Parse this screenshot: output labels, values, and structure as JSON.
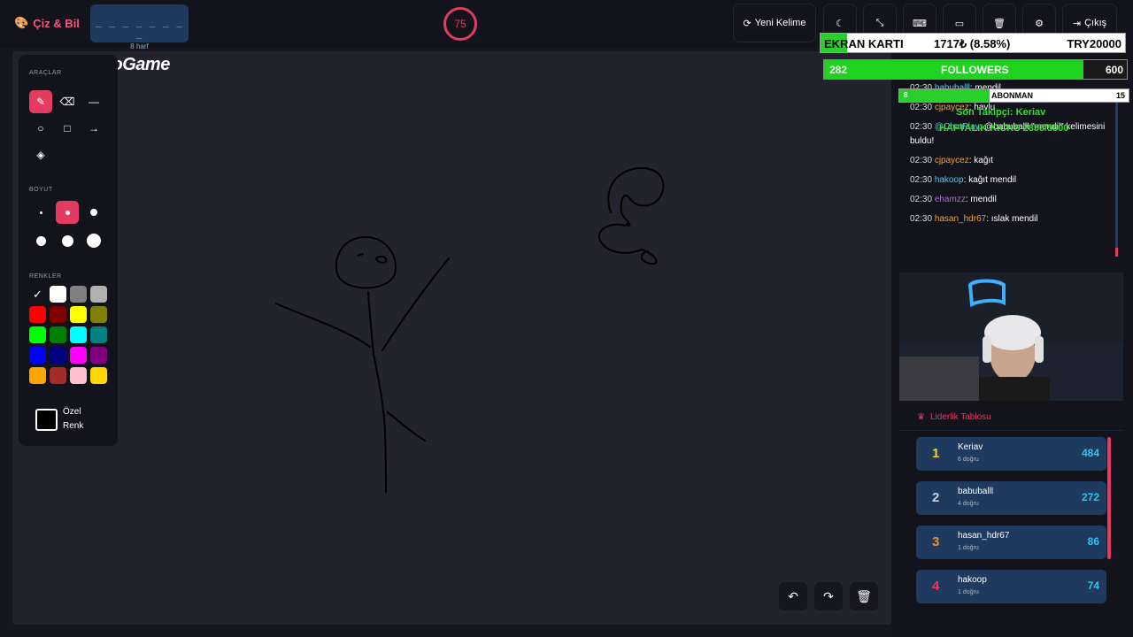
{
  "app": {
    "title": "Çiz & Bil"
  },
  "word": {
    "pattern": "_ _ _ _ _ _ _ _",
    "hint": "8 harf"
  },
  "timer": {
    "value": "75"
  },
  "toolbar": {
    "new_word_label": "Yeni Kelime",
    "exit_label": "Çıkış"
  },
  "overlay": {
    "brand": "ByNoGame",
    "ekran": {
      "label": "EKRAN KARTI",
      "value": "1717₺ (8.58%)",
      "target": "TRY20000"
    },
    "followers": {
      "current": "282",
      "label": "FOLLOWERS",
      "goal": "600"
    },
    "abonman": {
      "current": "8",
      "label": "ABONMAN",
      "goal": "15"
    },
    "last_follower": "Son Takipçi: Keriav",
    "weekly_kicks": "HAFTALIK KICKS 2850/5500"
  },
  "tools": {
    "section_tools": "ARAÇLAR",
    "section_size": "BOYUT",
    "section_colors": "RENKLER",
    "custom_color_line1": "Özel",
    "custom_color_line2": "Renk"
  },
  "colors": [
    "#ffffff",
    "#808080",
    "#b0b0b0",
    "#ff0000",
    "#800000",
    "#ffff00",
    "#808000",
    "#00ff00",
    "#008000",
    "#00ffff",
    "#008080",
    "#0000ff",
    "#000080",
    "#ff00ff",
    "#800080",
    "#ffa500",
    "#a52a2a",
    "#ffc0cb",
    "#ffd700"
  ],
  "chat": [
    {
      "time": "02:30",
      "user": "babuballl",
      "user_color": "#4ec9f0",
      "text": "mendil"
    },
    {
      "time": "02:30",
      "user": "cjpaycez",
      "user_color": "#f0a030",
      "text": "havlu"
    },
    {
      "time": "02:30",
      "user": "@ChatPlay",
      "user_color": "#4ec9f0",
      "text": "@babuballl \"mendil\" kelimesini buldu!"
    },
    {
      "time": "02:30",
      "user": "cjpaycez",
      "user_color": "#f0a030",
      "text": "kağıt"
    },
    {
      "time": "02:30",
      "user": "hakoop",
      "user_color": "#4ec9f0",
      "text": "kağıt mendil"
    },
    {
      "time": "02:30",
      "user": "ehamzz",
      "user_color": "#b06ad8",
      "text": "mendil"
    },
    {
      "time": "02:30",
      "user": "hasan_hdr67",
      "user_color": "#f0a030",
      "text": "ıslak mendil"
    }
  ],
  "leaderboard": {
    "title": "Liderlik Tablosu",
    "rows": [
      {
        "rank": "1",
        "name": "Keriav",
        "correct": "6 doğru",
        "points": "484",
        "rank_color": "#f5d020"
      },
      {
        "rank": "2",
        "name": "babuballl",
        "correct": "4 doğru",
        "points": "272",
        "rank_color": "#c8d0dc"
      },
      {
        "rank": "3",
        "name": "hasan_hdr67",
        "correct": "1 doğru",
        "points": "86",
        "rank_color": "#e8903a"
      },
      {
        "rank": "4",
        "name": "hakoop",
        "correct": "1 doğru",
        "points": "74",
        "rank_color": "#e33b62"
      }
    ]
  }
}
